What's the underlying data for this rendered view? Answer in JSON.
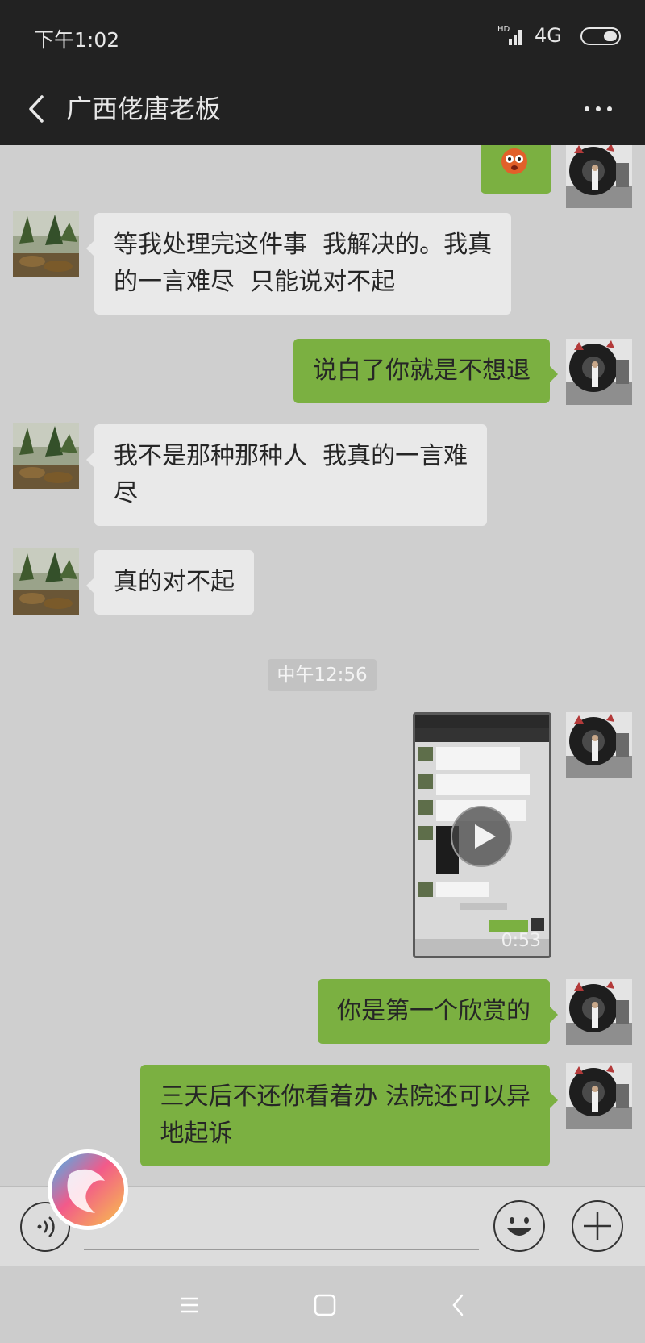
{
  "status_bar": {
    "time": "下午1:02",
    "network": "4G",
    "signal_label": "HD"
  },
  "header": {
    "title": "广西佬唐老板"
  },
  "messages": {
    "m1": "等我处理完这件事  我解决的。我真\n的一言难尽  只能说对不起",
    "m2": "说白了你就是不想退",
    "m3": "我不是那种那种人  我真的一言难\n尽",
    "m4": "真的对不起",
    "timestamp": "中午12:56",
    "video_duration": "0:53",
    "m5": "你是第一个欣赏的",
    "m6": "三天后不还你看着办 法院还可以异\n地起诉"
  },
  "icons": {
    "back": "back-arrow-icon",
    "more": "more-dots-icon",
    "voice": "voice-input-icon",
    "emoji": "emoji-icon",
    "plus": "plus-icon",
    "play": "play-icon",
    "assistant": "assistant-ball-icon"
  },
  "colors": {
    "outgoing_bubble": "#7bb041",
    "incoming_bubble": "#e9e9e9",
    "header_bg": "#222222",
    "chat_bg": "#cfcfcf"
  }
}
